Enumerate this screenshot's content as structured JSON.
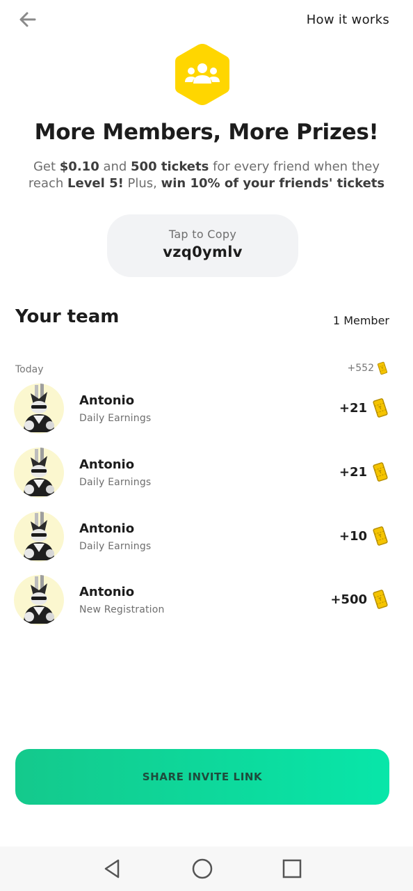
{
  "header": {
    "back_icon": "arrow-left-icon",
    "how_it_works": "How it works"
  },
  "hero": {
    "icon": "team-icon",
    "icon_color": "#ffd600",
    "title": "More Members, More Prizes!",
    "desc": {
      "p1": "Get ",
      "amount": "$0.10",
      "p2": " and ",
      "tickets": "500 tickets",
      "p3": " for every friend when they reach ",
      "level": "Level 5!",
      "p4": " Plus, ",
      "bonus": "win 10% of your friends' tickets"
    }
  },
  "referral": {
    "hint": "Tap to Copy",
    "code": "vzq0ymlv"
  },
  "team": {
    "title": "Your team",
    "count": "1 Member",
    "day_label": "Today",
    "day_total": "+552",
    "entries": [
      {
        "name": "Antonio",
        "desc": "Daily Earnings",
        "amount": "+21"
      },
      {
        "name": "Antonio",
        "desc": "Daily Earnings",
        "amount": "+21"
      },
      {
        "name": "Antonio",
        "desc": "Daily Earnings",
        "amount": "+10"
      },
      {
        "name": "Antonio",
        "desc": "New Registration",
        "amount": "+500"
      }
    ]
  },
  "share": {
    "label": "SHARE INVITE LINK",
    "gradient_start": "#14c98c",
    "gradient_end": "#08e6a9"
  },
  "system_nav": {
    "back": "nav-back-icon",
    "home": "nav-home-icon",
    "recents": "nav-recents-icon"
  }
}
